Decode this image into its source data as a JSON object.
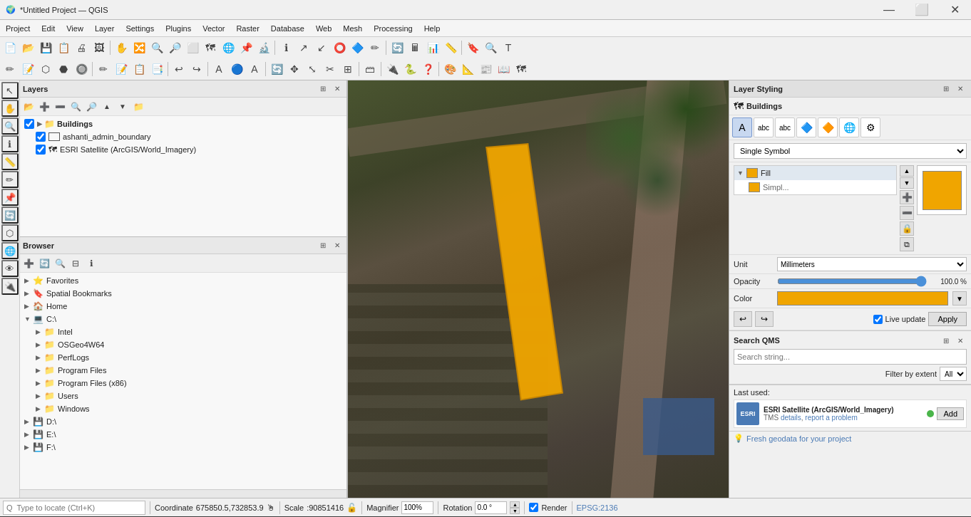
{
  "titlebar": {
    "title": "*Untitled Project — QGIS",
    "app_icon": "🌍",
    "minimize": "—",
    "maximize": "⬜",
    "close": "✕"
  },
  "menubar": {
    "items": [
      "Project",
      "Edit",
      "View",
      "Layer",
      "Settings",
      "Plugins",
      "Vector",
      "Raster",
      "Database",
      "Web",
      "Mesh",
      "Processing",
      "Help"
    ]
  },
  "layers_panel": {
    "title": "Layers",
    "items": [
      {
        "name": "Buildings",
        "type": "group",
        "checked": true,
        "indent": 0
      },
      {
        "name": "ashanti_admin_boundary",
        "type": "layer",
        "checked": true,
        "indent": 1
      },
      {
        "name": "ESRI Satellite (ArcGIS/World_Imagery)",
        "type": "raster",
        "checked": true,
        "indent": 1
      }
    ]
  },
  "browser_panel": {
    "title": "Browser",
    "items": [
      {
        "name": "Favorites",
        "indent": 0,
        "expanded": false
      },
      {
        "name": "Spatial Bookmarks",
        "indent": 0,
        "expanded": false
      },
      {
        "name": "Home",
        "indent": 0,
        "expanded": false
      },
      {
        "name": "C:\\",
        "indent": 0,
        "expanded": true
      },
      {
        "name": "Intel",
        "indent": 1,
        "expanded": false
      },
      {
        "name": "OSGeo4W64",
        "indent": 1,
        "expanded": false
      },
      {
        "name": "PerfLogs",
        "indent": 1,
        "expanded": false
      },
      {
        "name": "Program Files",
        "indent": 1,
        "expanded": false
      },
      {
        "name": "Program Files (x86)",
        "indent": 1,
        "expanded": false
      },
      {
        "name": "Users",
        "indent": 1,
        "expanded": false
      },
      {
        "name": "Windows",
        "indent": 1,
        "expanded": false
      },
      {
        "name": "D:\\",
        "indent": 0,
        "expanded": false
      },
      {
        "name": "E:\\",
        "indent": 0,
        "expanded": false
      },
      {
        "name": "F:\\",
        "indent": 0,
        "expanded": false
      }
    ]
  },
  "layer_styling": {
    "title": "Layer Styling",
    "layer_name": "Buildings",
    "symbol_type": "Single Symbol",
    "symbol_tree": {
      "fill_label": "Fill",
      "simpl_label": "Simpl..."
    },
    "unit_label": "Unit",
    "unit_value": "Millimeters",
    "opacity_label": "Opacity",
    "opacity_value": "100.0 %",
    "color_label": "Color",
    "live_update_label": "Live update",
    "apply_label": "Apply"
  },
  "search_qms": {
    "title": "Search QMS",
    "placeholder": "Search string...",
    "filter_label": "Filter by extent",
    "filter_value": "All"
  },
  "last_used": {
    "label": "Last used:",
    "item_name": "ESRI Satellite (ArcGIS/World_Imagery)",
    "item_sub": "TMS",
    "link1": "details",
    "link2": "report a problem",
    "add_label": "Add"
  },
  "fresh_geodata": {
    "icon": "💡",
    "text": "Fresh geodata for your project"
  },
  "statusbar": {
    "search_placeholder": "Q  Type to locate (Ctrl+K)",
    "coordinate_label": "Coordinate",
    "coordinate_value": "675850.5,732853.9",
    "scale_label": "Scale",
    "scale_value": ":90851416",
    "magnifier_label": "Magnifier",
    "magnifier_value": "100%",
    "rotation_label": "Rotation",
    "rotation_value": "0.0 °",
    "render_label": "Render",
    "epsg_label": "EPSG:2136"
  }
}
